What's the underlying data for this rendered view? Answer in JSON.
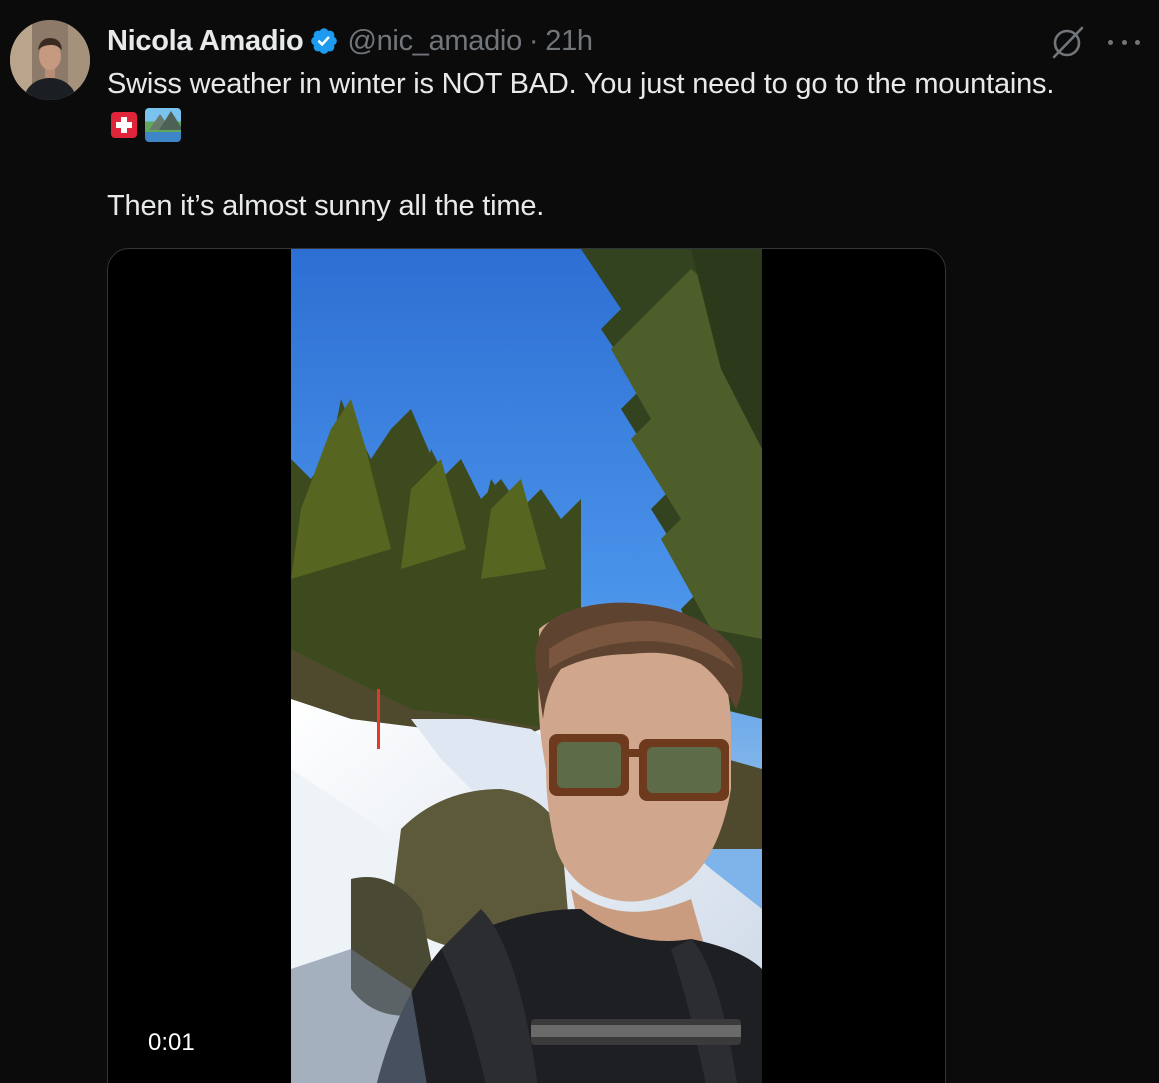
{
  "author": {
    "name": "Nicola Amadio",
    "handle": "@nic_amadio",
    "separator": "·",
    "time": "21h",
    "verified": true
  },
  "tweet": {
    "line1": "Swiss weather in winter is NOT BAD. You just need to go to the mountains.",
    "emojis": [
      "swiss-flag-emoji",
      "landscape-emoji"
    ],
    "line2": "Then it’s almost sunny all the time."
  },
  "media": {
    "type": "video",
    "timestamp": "0:01"
  },
  "colors": {
    "background": "#0b0b0b",
    "text": "#e7e9ea",
    "secondary": "#71767b",
    "verified": "#1d9bf0",
    "border": "#333639"
  },
  "icons": {
    "verified": "verified-badge-icon",
    "grok": "grok-icon",
    "more": "more-options-icon"
  }
}
